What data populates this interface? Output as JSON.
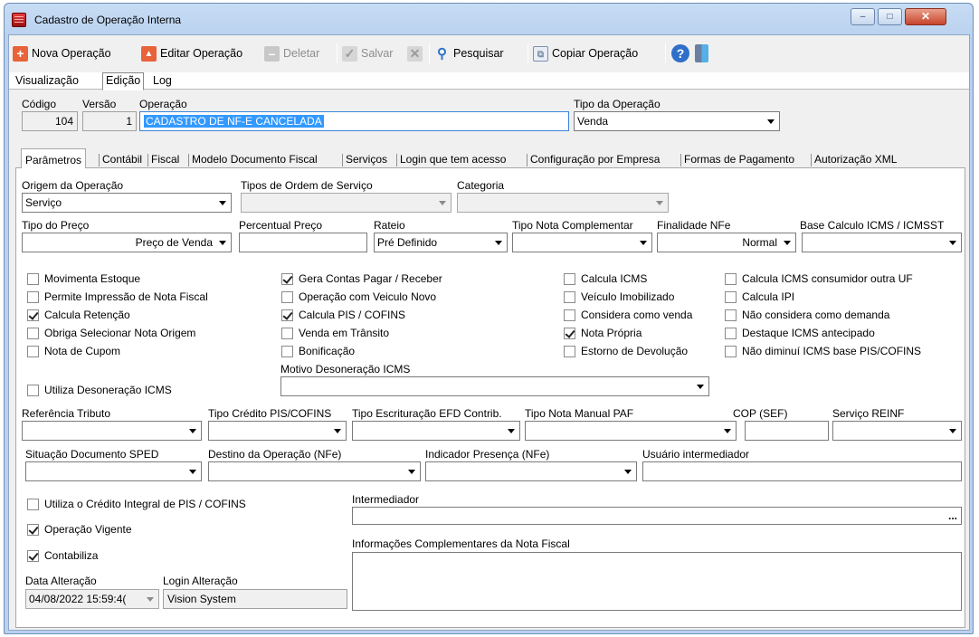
{
  "window": {
    "title": "Cadastro de Operação Interna",
    "minimize": "–",
    "maximize": "□",
    "close": "✕"
  },
  "toolbar": {
    "new": "Nova Operação",
    "edit": "Editar Operação",
    "delete": "Deletar",
    "save": "Salvar",
    "search": "Pesquisar",
    "copy": "Copiar Operação"
  },
  "view_tabs": [
    "Visualização",
    "Edição",
    "Log"
  ],
  "header": {
    "codigo_label": "Código",
    "codigo": "104",
    "versao_label": "Versão",
    "versao": "1",
    "operacao_label": "Operação",
    "operacao": "CADASTRO DE NF-E CANCELADA",
    "tipo_label": "Tipo da Operação",
    "tipo": "Venda"
  },
  "sub_tabs": [
    "Parâmetros",
    "Contábil",
    "Fiscal",
    "Modelo Documento Fiscal",
    "Serviços",
    "Login que tem acesso",
    "Configuração por Empresa",
    "Formas de Pagamento",
    "Autorização XML"
  ],
  "params": {
    "origem_label": "Origem da Operação",
    "origem": "Serviço",
    "tipos_os_label": "Tipos de Ordem de Serviço",
    "tipos_os": "",
    "categoria_label": "Categoria",
    "categoria": "",
    "tipo_preco_label": "Tipo do Preço",
    "tipo_preco": "Preço de Venda",
    "percentual_label": "Percentual Preço",
    "percentual": "",
    "rateio_label": "Rateio",
    "rateio": "Pré Definido",
    "nota_compl_label": "Tipo Nota Complementar",
    "nota_compl": "",
    "finalidade_label": "Finalidade NFe",
    "finalidade": "Normal",
    "base_icms_label": "Base Calculo ICMS / ICMSST",
    "base_icms": ""
  },
  "checkboxes": {
    "col1": [
      {
        "label": "Movimenta Estoque",
        "checked": false
      },
      {
        "label": "Permite Impressão de Nota Fiscal",
        "checked": false
      },
      {
        "label": "Calcula Retenção",
        "checked": true
      },
      {
        "label": "Obriga Selecionar Nota Origem",
        "checked": false
      },
      {
        "label": "Nota de Cupom",
        "checked": false
      }
    ],
    "col2": [
      {
        "label": "Gera Contas Pagar / Receber",
        "checked": true
      },
      {
        "label": "Operação com Veiculo Novo",
        "checked": false
      },
      {
        "label": "Calcula PIS / COFINS",
        "checked": true
      },
      {
        "label": "Venda em Trânsito",
        "checked": false
      },
      {
        "label": "Bonificação",
        "checked": false
      }
    ],
    "col3": [
      {
        "label": "Calcula ICMS",
        "checked": false
      },
      {
        "label": "Veículo Imobilizado",
        "checked": false
      },
      {
        "label": "Considera como venda",
        "checked": false
      },
      {
        "label": "Nota Própria",
        "checked": true
      },
      {
        "label": "Estorno de Devolução",
        "checked": false
      }
    ],
    "col4": [
      {
        "label": "Calcula ICMS consumidor outra UF",
        "checked": false
      },
      {
        "label": "Calcula IPI",
        "checked": false
      },
      {
        "label": "Não considera como demanda",
        "checked": false
      },
      {
        "label": "Destaque ICMS antecipado",
        "checked": false
      },
      {
        "label": "Não diminuí ICMS base PIS/COFINS",
        "checked": false
      }
    ],
    "desoneracao": {
      "label": "Utiliza Desoneração ICMS",
      "checked": false
    },
    "credito_integral": {
      "label": "Utiliza o Crédito Integral de PIS / COFINS",
      "checked": false
    },
    "vigente": {
      "label": "Operação Vigente",
      "checked": true
    },
    "contabiliza": {
      "label": "Contabiliza",
      "checked": true
    }
  },
  "fiscal": {
    "motivo_label": "Motivo Desoneração ICMS",
    "motivo": "",
    "ref_tributo_label": "Referência Tributo",
    "credito_pis_label": "Tipo Crédito PIS/COFINS",
    "escrituracao_label": "Tipo Escrituração EFD Contrib.",
    "nota_manual_label": "Tipo Nota Manual PAF",
    "cop_label": "COP (SEF)",
    "reinf_label": "Serviço REINF",
    "situacao_label": "Situação Documento SPED",
    "destino_label": "Destino da Operação (NFe)",
    "presenca_label": "Indicador Presença (NFe)",
    "usuario_label": "Usuário intermediador",
    "intermediador_label": "Intermediador",
    "intermediador_btn": "...",
    "info_label": "Informações Complementares da Nota Fiscal"
  },
  "footer": {
    "data_label": "Data Alteração",
    "data": "04/08/2022 15:59:4(",
    "login_label": "Login Alteração",
    "login": "Vision System"
  },
  "colors": {
    "accent": "#3399ff",
    "title_bg": "#b9d1ee",
    "close_red": "#c7442b"
  }
}
